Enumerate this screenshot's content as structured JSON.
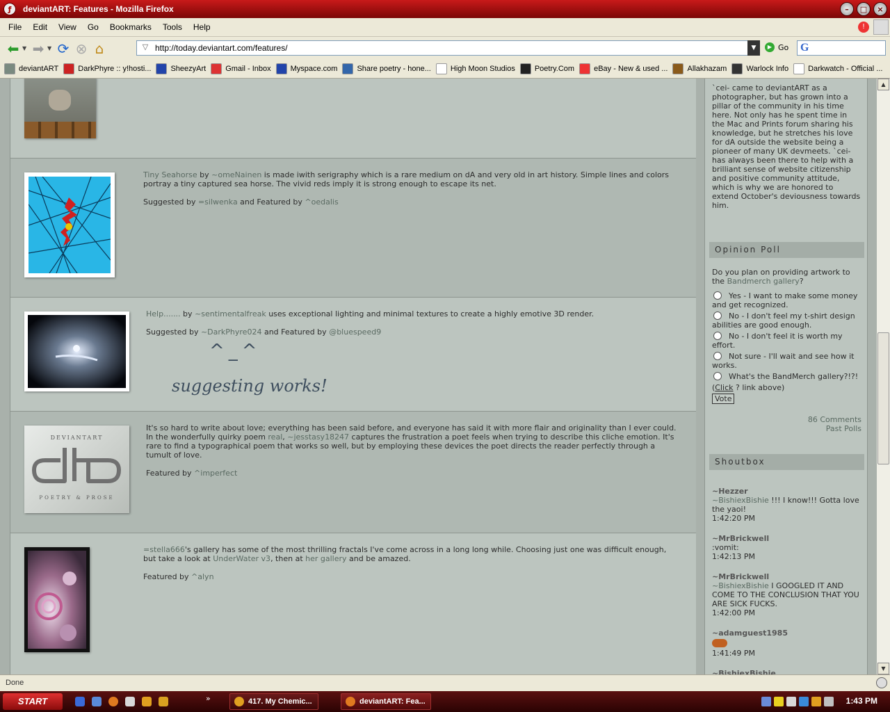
{
  "window": {
    "title": "deviantART: Features - Mozilla Firefox"
  },
  "menu": [
    "File",
    "Edit",
    "View",
    "Go",
    "Bookmarks",
    "Tools",
    "Help"
  ],
  "nav": {
    "url": "http://today.deviantart.com/features/",
    "go_label": "Go"
  },
  "bookmarks": [
    {
      "label": "deviantART",
      "icon": "deviantart-icon",
      "color": "#7a8a80"
    },
    {
      "label": "DarkPhyre :: y!hosti...",
      "icon": "yahoo-icon",
      "color": "#c22"
    },
    {
      "label": "SheezyArt",
      "icon": "sheezyart-icon",
      "color": "#2244aa"
    },
    {
      "label": "Gmail - Inbox",
      "icon": "gmail-icon",
      "color": "#d33"
    },
    {
      "label": "Myspace.com",
      "icon": "myspace-icon",
      "color": "#2244aa"
    },
    {
      "label": "Share poetry - hone...",
      "icon": "poetry-icon",
      "color": "#3366aa"
    },
    {
      "label": "High Moon Studios",
      "icon": "page-icon",
      "color": "#ffffff"
    },
    {
      "label": "Poetry.Com",
      "icon": "poetrycom-icon",
      "color": "#222"
    },
    {
      "label": "eBay - New & used ...",
      "icon": "ebay-icon",
      "color": "#e33"
    },
    {
      "label": "Allakhazam",
      "icon": "allakhazam-icon",
      "color": "#8a5a1a"
    },
    {
      "label": "Warlock Info",
      "icon": "warlock-icon",
      "color": "#333"
    },
    {
      "label": "Darkwatch - Official ...",
      "icon": "page-icon",
      "color": "#ffffff"
    }
  ],
  "features": {
    "f1": {
      "title_link": "Tiny Seahorse",
      "by": " by ",
      "artist": "~omeNainen",
      "desc": " is made iwith serigraphy which is a rare medium on dA and very old in art history. Simple lines and colors portray a tiny captured sea horse. The vivid reds imply it is strong enough to escape its net.",
      "suggested_prefix": "Suggested by ",
      "suggester": "=silwenka",
      "featured_prefix": " and Featured by ",
      "featurer": "^oedalis"
    },
    "f2": {
      "title_link": "Help.......",
      "by": " by ",
      "artist": "~sentimentalfreak",
      "desc": " uses exceptional lighting and minimal textures to create a highly emotive 3D render.",
      "suggested_prefix": "Suggested by ",
      "suggester": "~DarkPhyre024",
      "featured_prefix": " and Featured by ",
      "featurer": "@bluespeed9",
      "emoticon": "^_^",
      "handwritten": "suggesting works!"
    },
    "f3": {
      "desc_a": "It's so hard to write about love; everything has been said before, and everyone has said it with more flair and originality than I ever could. In the wonderfully quirky poem ",
      "poem": "real",
      "comma": ", ",
      "artist": "~jesstasy18247",
      "desc_b": " captures the frustration a poet feels when trying to describe this cliche emotion. It's rare to find a typographical poem that works so well, but by employing these devices the poet directs the reader perfectly through a tumult of love.",
      "featured_prefix": "Featured by ",
      "featurer": "^imperfect",
      "logo_top": "DEVIANTART",
      "logo_bottom": "POETRY & PROSE"
    },
    "f4": {
      "artist": "=stella666",
      "desc_a": "'s gallery has some of the most thrilling fractals I've come across in a long long while. Choosing just one was difficult enough, but take a look at ",
      "work": "UnderWater v3",
      "desc_b": ", then at ",
      "gallery": "her gallery",
      "desc_c": " and be amazed.",
      "featured_prefix": "Featured by ",
      "featurer": "^alyn"
    }
  },
  "sidebar": {
    "intro": "`cei- came to deviantART as a photographer, but has grown into a pillar of the community in his time here. Not only has he spent time in the Mac and Prints forum sharing his knowledge, but he stretches his love for dA outside the website being a pioneer of many UK devmeets. `cei- has always been there to help with a brilliant sense of website citizenship and positive community attitude, which is why we are honored to extend October's deviousness towards him.",
    "poll": {
      "heading": "Opinion Poll",
      "q_prefix": "Do you plan on providing artwork to the ",
      "q_link": "Bandmerch gallery",
      "q_suffix": "?",
      "options": [
        "Yes - I want to make some money and get recognized.",
        "No - I don't feel my t-shirt design abilities are good enough.",
        "No - I don't feel it is worth my effort.",
        "Not sure - I'll wait and see how it works.",
        "What's the BandMerch gallery?!?!"
      ],
      "click_note_a": "(",
      "click_link": "Click",
      "click_note_b": " ? link above)",
      "vote": "Vote",
      "comments": "86 Comments",
      "past": "Past Polls"
    },
    "shoutbox": {
      "heading": "Shoutbox",
      "entries": [
        {
          "name": "~Hezzer",
          "to": "~BishiexBishie",
          "msg": " !!! I know!!! Gotta love the yaoi!",
          "time": "1:42:20 PM"
        },
        {
          "name": "~MrBrickwell",
          "to": "",
          "msg": ":vomit:",
          "time": "1:42:13 PM"
        },
        {
          "name": "~MrBrickwell",
          "to": "~BishiexBishie",
          "msg": " I GOOGLED IT AND COME TO THE CONCLUSION THAT YOU ARE SICK FUCKS.",
          "time": "1:42:00 PM"
        },
        {
          "name": "~adamguest1985",
          "to": "",
          "msg": "",
          "time": "1:41:49 PM"
        },
        {
          "name": "~BishiexBishie",
          "to": "",
          "msg": "",
          "time": ""
        }
      ]
    }
  },
  "status": "Done",
  "taskbar": {
    "start": "START",
    "tasks": [
      "417. My Chemic...",
      "deviantART: Fea..."
    ],
    "clock": "1:43 PM"
  }
}
